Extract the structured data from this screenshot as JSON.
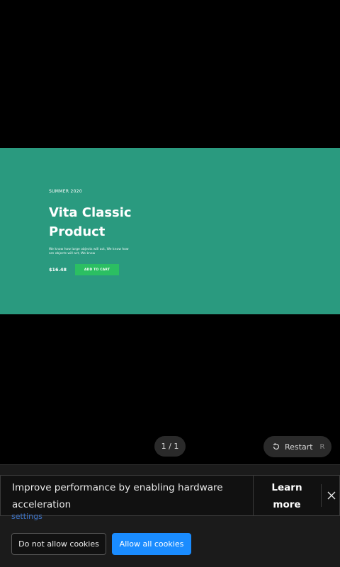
{
  "slide": {
    "eyebrow": "SUMMER 2020",
    "title": "Vita Classic Product",
    "description": "We know how large objects will act, We know how are objects will act, We know",
    "price": "$16.48",
    "cart_label": "ADD TO CART",
    "background_color": "#2a9a7f",
    "button_color": "#2bbf62"
  },
  "player": {
    "counter": "1 / 1",
    "restart_label": "Restart",
    "restart_shortcut": "R"
  },
  "cookie_banner": {
    "message": "Improve performance by enabling hardware acceleration",
    "learn_more": "Learn more",
    "settings_link": "settings",
    "deny_label": "Do not allow cookies",
    "allow_label": "Allow all cookies",
    "allow_color": "#1a8cff"
  }
}
